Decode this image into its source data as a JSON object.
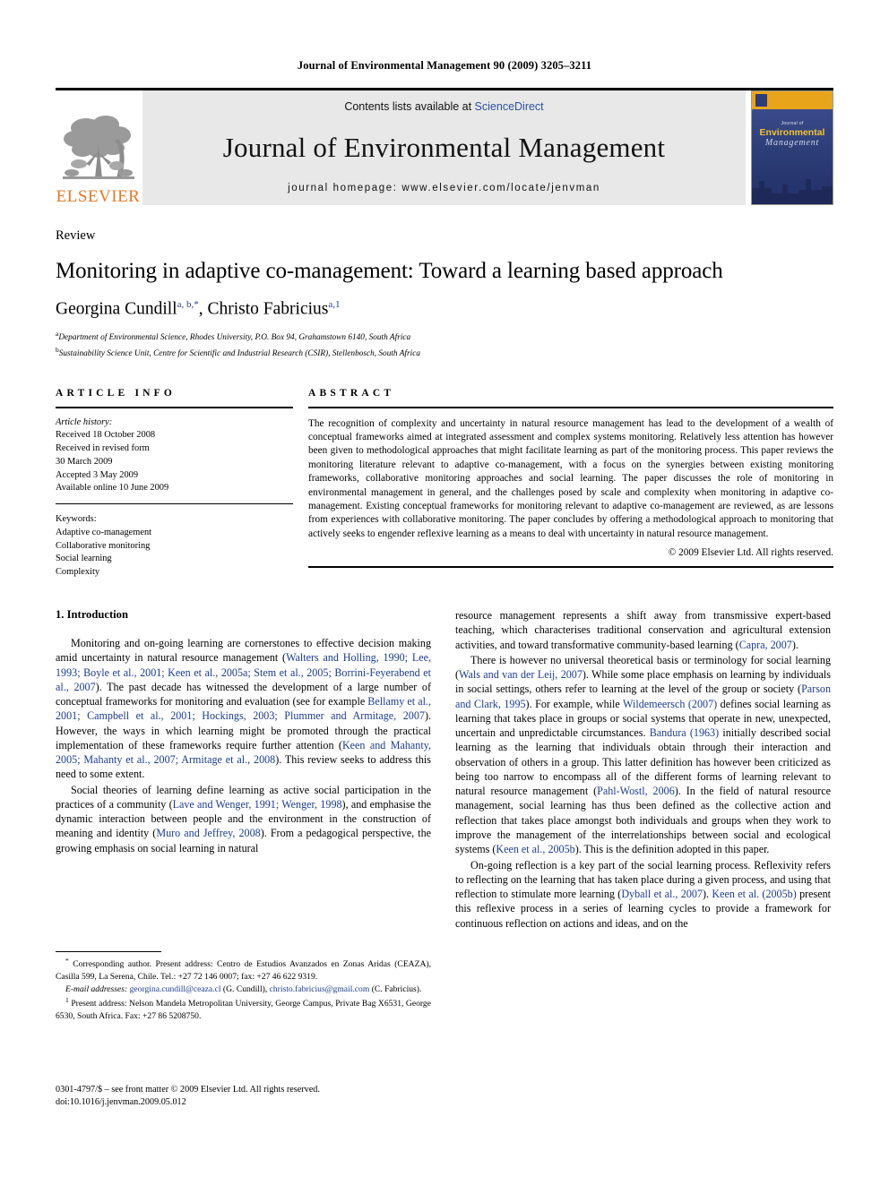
{
  "running_head": "Journal of Environmental Management 90 (2009) 3205–3211",
  "masthead": {
    "publisher_wordmark": "ELSEVIER",
    "contents_prefix": "Contents lists available at ",
    "contents_link": "ScienceDirect",
    "journal_title": "Journal of Environmental Management",
    "homepage": "journal homepage: www.elsevier.com/locate/jenvman",
    "cover": {
      "line1": "Journal of",
      "line2": "Environmental",
      "line3": "Management"
    }
  },
  "article": {
    "type_label": "Review",
    "title": "Monitoring in adaptive co-management: Toward a learning based approach",
    "authors": "Georgina Cundill",
    "author1_sup": "a, b,*",
    "author2": ", Christo Fabricius",
    "author2_sup": "a,1",
    "affiliation_a_sup": "a",
    "affiliation_a": "Department of Environmental Science, Rhodes University, P.O. Box 94, Grahamstown 6140, South Africa",
    "affiliation_b_sup": "b",
    "affiliation_b": "Sustainability Science Unit, Centre for Scientific and Industrial Research (CSIR), Stellenbosch, South Africa"
  },
  "info": {
    "heading": "ARTICLE INFO",
    "history_label": "Article history:",
    "history": [
      "Received 18 October 2008",
      "Received in revised form",
      "30 March 2009",
      "Accepted 3 May 2009",
      "Available online 10 June 2009"
    ],
    "keywords_label": "Keywords:",
    "keywords": [
      "Adaptive co-management",
      "Collaborative monitoring",
      "Social learning",
      "Complexity"
    ]
  },
  "abstract": {
    "heading": "ABSTRACT",
    "text": "The recognition of complexity and uncertainty in natural resource management has lead to the development of a wealth of conceptual frameworks aimed at integrated assessment and complex systems monitoring. Relatively less attention has however been given to methodological approaches that might facilitate learning as part of the monitoring process. This paper reviews the monitoring literature relevant to adaptive co-management, with a focus on the synergies between existing monitoring frameworks, collaborative monitoring approaches and social learning. The paper discusses the role of monitoring in environmental management in general, and the challenges posed by scale and complexity when monitoring in adaptive co-management. Existing conceptual frameworks for monitoring relevant to adaptive co-management are reviewed, as are lessons from experiences with collaborative monitoring. The paper concludes by offering a methodological approach to monitoring that actively seeks to engender reflexive learning as a means to deal with uncertainty in natural resource management.",
    "copyright": "© 2009 Elsevier Ltd. All rights reserved."
  },
  "body": {
    "section_heading": "1. Introduction",
    "left_paragraphs": [
      {
        "parts": [
          {
            "t": "Monitoring and on-going learning are cornerstones to effective decision making amid uncertainty in natural resource management ("
          },
          {
            "t": "Walters and Holling, 1990; Lee, 1993; Boyle et al., 2001; Keen et al., 2005a; Stem et al., 2005; Borrini-Feyerabend et al., 2007",
            "cite": true
          },
          {
            "t": "). The past decade has witnessed the development of a large number of conceptual frameworks for monitoring and evaluation (see for example "
          },
          {
            "t": "Bellamy et al., 2001; Campbell et al., 2001; Hockings, 2003; Plummer and Armitage, 2007",
            "cite": true
          },
          {
            "t": "). However, the ways in which learning might be promoted through the practical implementation of these frameworks require further attention ("
          },
          {
            "t": "Keen and Mahanty, 2005; Mahanty et al., 2007; Armitage et al., 2008",
            "cite": true
          },
          {
            "t": "). This review seeks to address this need to some extent."
          }
        ]
      },
      {
        "parts": [
          {
            "t": "Social theories of learning define learning as active social participation in the practices of a community ("
          },
          {
            "t": "Lave and Wenger, 1991; Wenger, 1998",
            "cite": true
          },
          {
            "t": "), and emphasise the dynamic interaction between people and the environment in the construction of meaning and identity ("
          },
          {
            "t": "Muro and Jeffrey, 2008",
            "cite": true
          },
          {
            "t": "). From a pedagogical perspective, the growing emphasis on social learning in natural"
          }
        ]
      }
    ],
    "right_paragraphs": [
      {
        "noindent": true,
        "parts": [
          {
            "t": "resource management represents a shift away from transmissive expert-based teaching, which characterises traditional conservation and agricultural extension activities, and toward transformative community-based learning ("
          },
          {
            "t": "Capra, 2007",
            "cite": true
          },
          {
            "t": ")."
          }
        ]
      },
      {
        "parts": [
          {
            "t": "There is however no universal theoretical basis or terminology for social learning ("
          },
          {
            "t": "Wals and van der Leij, 2007",
            "cite": true
          },
          {
            "t": "). While some place emphasis on learning by individuals in social settings, others refer to learning at the level of the group or society ("
          },
          {
            "t": "Parson and Clark, 1995",
            "cite": true
          },
          {
            "t": "). For example, while "
          },
          {
            "t": "Wildemeersch (2007)",
            "cite": true
          },
          {
            "t": " defines social learning as learning that takes place in groups or social systems that operate in new, unexpected, uncertain and unpredictable circumstances. "
          },
          {
            "t": "Bandura (1963)",
            "cite": true
          },
          {
            "t": " initially described social learning as the learning that individuals obtain through their interaction and observation of others in a group. This latter definition has however been criticized as being too narrow to encompass all of the different forms of learning relevant to natural resource management ("
          },
          {
            "t": "Pahl-Wostl, 2006",
            "cite": true
          },
          {
            "t": "). In the field of natural resource management, social learning has thus been defined as the collective action and reflection that takes place amongst both individuals and groups when they work to improve the management of the interrelationships between social and ecological systems ("
          },
          {
            "t": "Keen et al., 2005b",
            "cite": true
          },
          {
            "t": "). This is the definition adopted in this paper."
          }
        ]
      },
      {
        "parts": [
          {
            "t": "On-going reflection is a key part of the social learning process. Reflexivity refers to reflecting on the learning that has taken place during a given process, and using that reflection to stimulate more learning ("
          },
          {
            "t": "Dyball et al., 2007",
            "cite": true
          },
          {
            "t": "). "
          },
          {
            "t": "Keen et al. (2005b)",
            "cite": true
          },
          {
            "t": " present this reflexive process in a series of learning cycles to provide a framework for continuous reflection on actions and ideas, and on the"
          }
        ]
      }
    ]
  },
  "footnotes": {
    "corresponding_marker": "*",
    "corresponding": " Corresponding author. Present address: Centro de Estudios Avanzados en Zonas Aridas (CEAZA), Casilla 599, La Serena, Chile. Tel.: +27 72 146 0007; fax: +27 46 622 9319.",
    "email_label": "E-mail addresses:",
    "email1": "georgina.cundill@ceaza.cl",
    "email1_owner": " (G. Cundill), ",
    "email2": "christo.fabricius@gmail.com",
    "email2_owner": " (C. Fabricius).",
    "present_marker": "1",
    "present_address": " Present address: Nelson Mandela Metropolitan University, George Campus, Private Bag X6531, George 6530, South Africa. Fax: +27 86 5208750."
  },
  "footer": {
    "issn_line": "0301-4797/$ – see front matter © 2009 Elsevier Ltd. All rights reserved.",
    "doi_line": "doi:10.1016/j.jenvman.2009.05.012"
  }
}
